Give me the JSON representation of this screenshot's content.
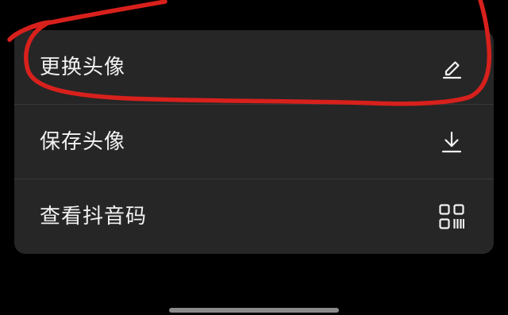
{
  "menu": {
    "items": [
      {
        "label": "更换头像",
        "icon": "edit-pencil-icon"
      },
      {
        "label": "保存头像",
        "icon": "download-icon"
      },
      {
        "label": "查看抖音码",
        "icon": "qr-code-icon"
      }
    ]
  },
  "colors": {
    "background": "#000000",
    "menu_background": "#262626",
    "text": "#f2f2f2",
    "divider": "#3a3a3a",
    "annotation": "#d8201c",
    "home_indicator": "#8a8a8a"
  }
}
